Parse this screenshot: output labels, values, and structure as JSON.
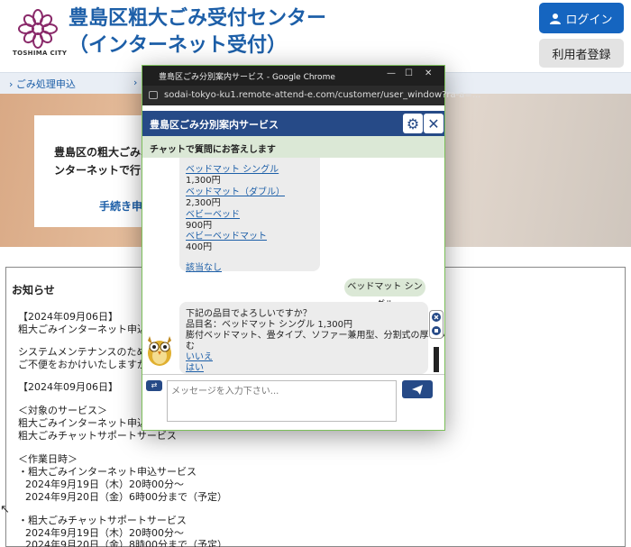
{
  "site": {
    "logo_text": "TOSHIMA CITY",
    "title_line1": "豊島区粗大ごみ受付センター",
    "title_line2": "（インターネット受付）",
    "login_label": "ログイン",
    "register_label": "利用者登録",
    "nav_item": "ごみ処理申込",
    "nav_arrow2": "›"
  },
  "hero": {
    "line1": "豊島区の粗大ごみ収",
    "line2": "ンターネットで行う",
    "link": "手続き申込"
  },
  "notice": {
    "title": "お知らせ",
    "lines": [
      "【2024年09月06日】",
      "粗大ごみインターネット申込サー",
      "システムメンテナンスのため、下",
      "ご不便をおかけいたしますが、ご",
      "【2024年09月06日】",
      "＜対象のサービス＞",
      "粗大ごみインターネット申込サー",
      "粗大ごみチャットサポートサービス",
      "＜作業日時＞",
      "・粗大ごみインターネット申込サービス",
      "2024年9月19日（木）20時00分～",
      "2024年9月20日（金）6時00分まで（予定）",
      "・粗大ごみチャットサポートサービス",
      "2024年9月19日（木）20時00分～",
      "2024年9月20日（金）8時00分まで（予定）"
    ]
  },
  "browser": {
    "window_title": "豊島区ごみ分別案内サービス - Google Chrome",
    "url": "sodai-tokyo-ku1.remote-attend-e.com/customer/user_window?ra-a=..."
  },
  "chat": {
    "header": "豊島区ごみ分別案内サービス",
    "subheader": "チャットで質問にお答えします",
    "options": [
      {
        "label": "ベッドマット シングル",
        "price": "1,300円"
      },
      {
        "label": "ベッドマット（ダブル）",
        "price": "2,300円"
      },
      {
        "label": "ベビーベッド",
        "price": "900円"
      },
      {
        "label": "ベビーベッドマット",
        "price": "400円"
      }
    ],
    "none_option": "該当なし",
    "user_message": "ベッドマット シングル",
    "bot_confirm": "下記の品目でよろしいですか？",
    "bot_item": "品目名：ベッドマット シングル 1,300円",
    "bot_desc1": "膨付ベッドマット、畳タイプ、ソファー兼用型、分割式の厚マットレスを含",
    "bot_desc2": "む",
    "answer_no": "いいえ",
    "answer_yes": "はい",
    "input_placeholder": "メッセージを入力下さい..."
  },
  "colors": {
    "brand_blue": "#1d5fa8",
    "chat_header": "#264a87",
    "chat_sub": "#dbe8d6"
  }
}
